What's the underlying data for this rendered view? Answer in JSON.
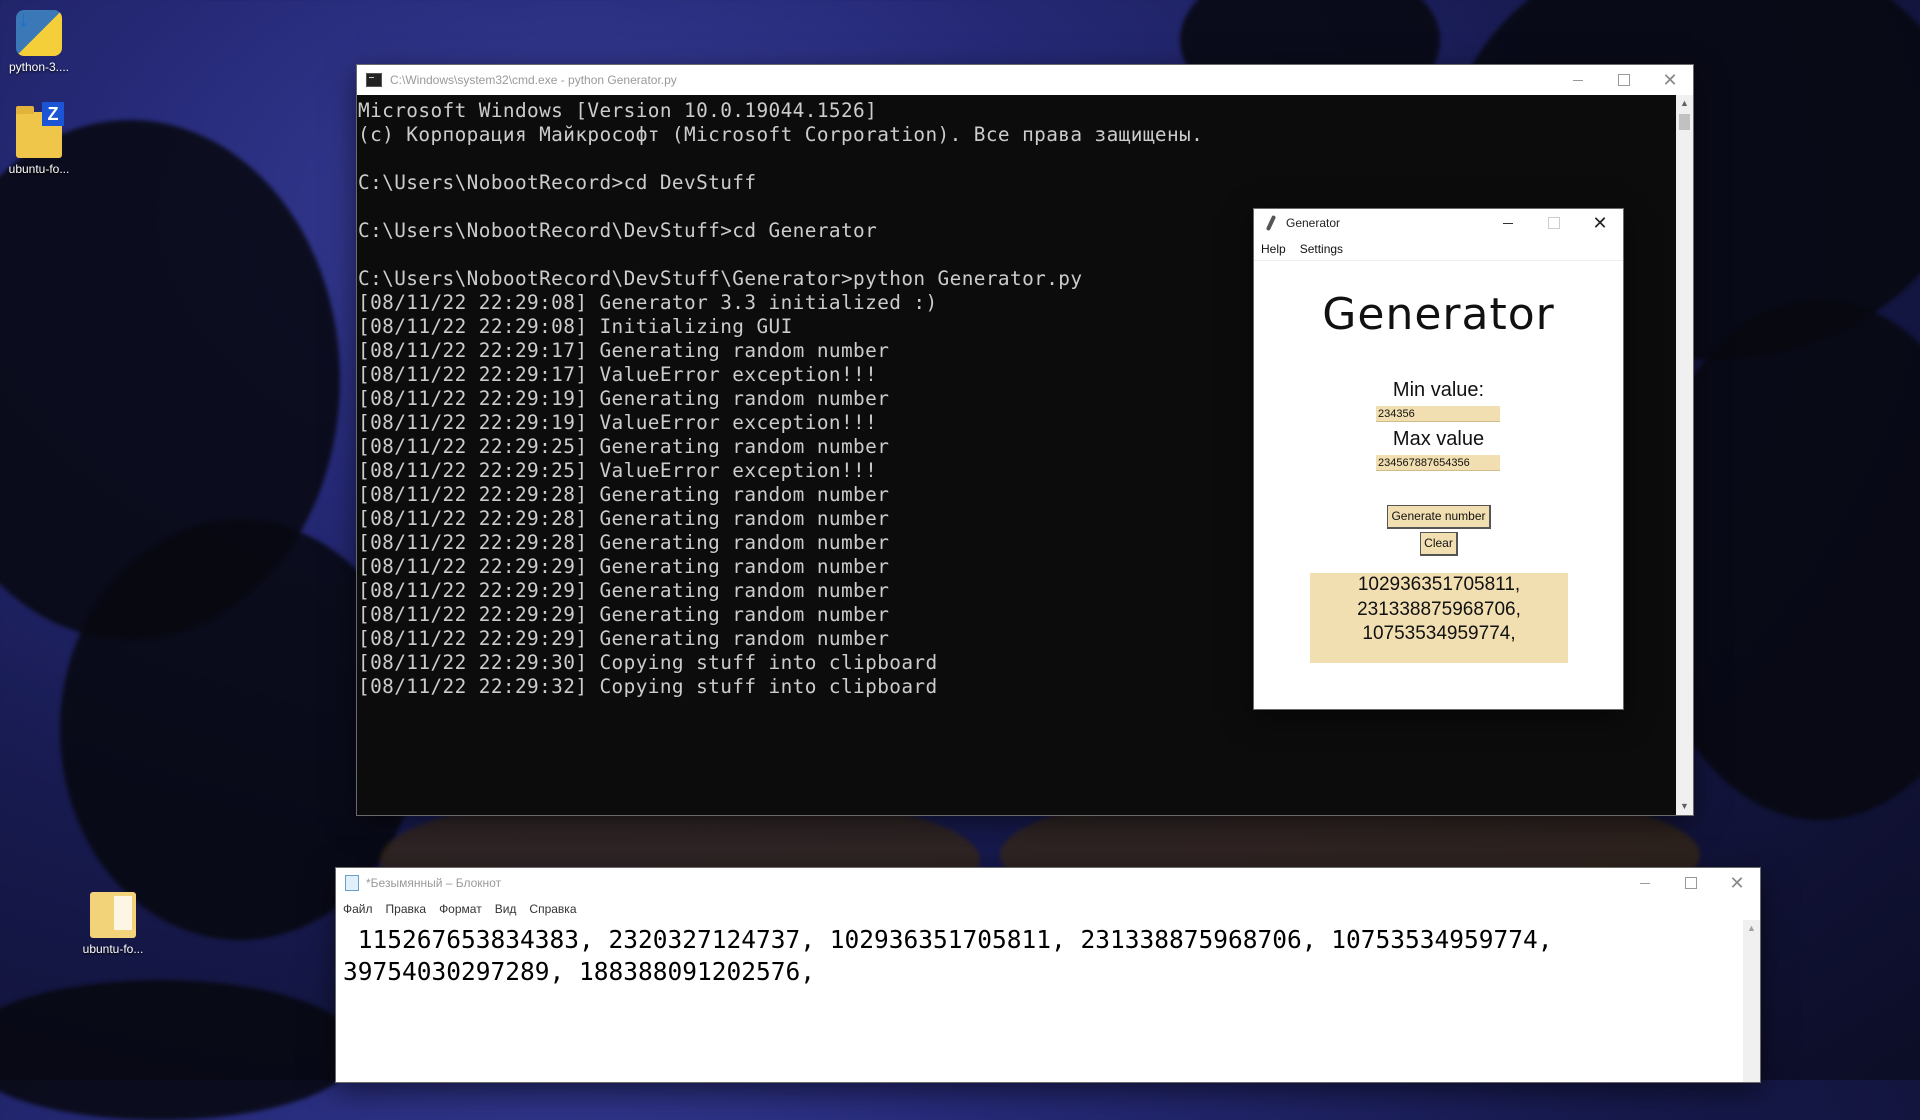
{
  "desktop": {
    "icons": [
      {
        "label": "python-3...."
      },
      {
        "label": "ubuntu-fo..."
      },
      {
        "label": "ubuntu-fo..."
      }
    ]
  },
  "cmd": {
    "title": "C:\\Windows\\system32\\cmd.exe - python  Generator.py",
    "lines": [
      "Microsoft Windows [Version 10.0.19044.1526]",
      "(c) Корпорация Майкрософт (Microsoft Corporation). Все права защищены.",
      "",
      "C:\\Users\\NobootRecord>cd DevStuff",
      "",
      "C:\\Users\\NobootRecord\\DevStuff>cd Generator",
      "",
      "C:\\Users\\NobootRecord\\DevStuff\\Generator>python Generator.py",
      "[08/11/22 22:29:08] Generator 3.3 initialized :)",
      "[08/11/22 22:29:08] Initializing GUI",
      "[08/11/22 22:29:17] Generating random number",
      "[08/11/22 22:29:17] ValueError exception!!!",
      "[08/11/22 22:29:19] Generating random number",
      "[08/11/22 22:29:19] ValueError exception!!!",
      "[08/11/22 22:29:25] Generating random number",
      "[08/11/22 22:29:25] ValueError exception!!!",
      "[08/11/22 22:29:28] Generating random number",
      "[08/11/22 22:29:28] Generating random number",
      "[08/11/22 22:29:28] Generating random number",
      "[08/11/22 22:29:29] Generating random number",
      "[08/11/22 22:29:29] Generating random number",
      "[08/11/22 22:29:29] Generating random number",
      "[08/11/22 22:29:29] Generating random number",
      "[08/11/22 22:29:30] Copying stuff into clipboard",
      "[08/11/22 22:29:32] Copying stuff into clipboard"
    ]
  },
  "generator": {
    "window_title": "Generator",
    "menu": [
      "Help",
      "Settings"
    ],
    "heading": "Generator",
    "min_label": "Min value:",
    "min_value": "234356",
    "max_label": "Max value",
    "max_value": "234567887654356",
    "generate_button": "Generate number",
    "clear_button": "Clear",
    "output_lines": [
      "102936351705811,",
      "231338875968706,",
      "10753534959774,"
    ]
  },
  "notepad": {
    "title": "*Безымянный – Блокнот",
    "menu": [
      "Файл",
      "Правка",
      "Формат",
      "Вид",
      "Справка"
    ],
    "content": " 115267653834383, 2320327124737, 102936351705811, 231338875968706, 10753534959774,\n39754030297289, 188388091202576,"
  }
}
